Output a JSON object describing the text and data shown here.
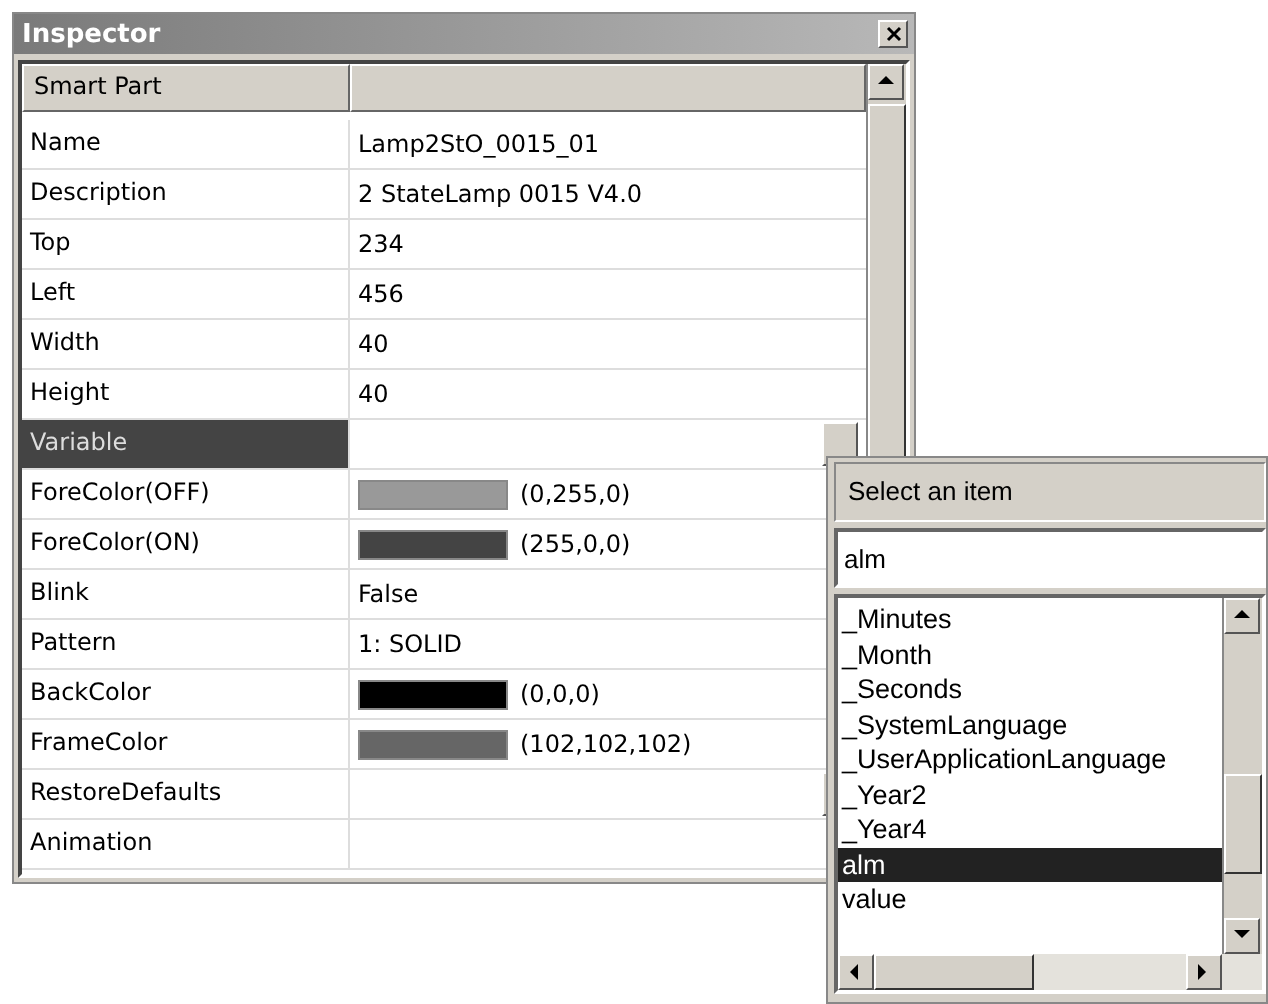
{
  "window": {
    "title": "Inspector"
  },
  "header": {
    "label": "Smart Part"
  },
  "rows": [
    {
      "name": "Name",
      "kind": "text",
      "value": "Lamp2StO_0015_01",
      "selected": false
    },
    {
      "name": "Description",
      "kind": "text",
      "value": "2 StateLamp 0015  V4.0",
      "selected": false
    },
    {
      "name": "Top",
      "kind": "text",
      "value": "234",
      "selected": false
    },
    {
      "name": "Left",
      "kind": "text",
      "value": "456",
      "selected": false
    },
    {
      "name": "Width",
      "kind": "text",
      "value": "40",
      "selected": false
    },
    {
      "name": "Height",
      "kind": "text",
      "value": "40",
      "selected": false
    },
    {
      "name": "Variable",
      "kind": "button",
      "value": "",
      "selected": true
    },
    {
      "name": "ForeColor(OFF)",
      "kind": "color",
      "value": "(0,255,0)",
      "color": "#999999",
      "selected": false
    },
    {
      "name": "ForeColor(ON)",
      "kind": "color",
      "value": "(255,0,0)",
      "color": "#444444",
      "selected": false
    },
    {
      "name": "Blink",
      "kind": "text",
      "value": "False",
      "selected": false
    },
    {
      "name": "Pattern",
      "kind": "text",
      "value": "1: SOLID",
      "selected": false
    },
    {
      "name": "BackColor",
      "kind": "color",
      "value": "(0,0,0)",
      "color": "#000000",
      "selected": false
    },
    {
      "name": "FrameColor",
      "kind": "color",
      "value": "(102,102,102)",
      "color": "#666666",
      "selected": false
    },
    {
      "name": "RestoreDefaults",
      "kind": "button",
      "value": "",
      "selected": false
    },
    {
      "name": "Animation",
      "kind": "text",
      "value": "",
      "selected": false
    }
  ],
  "popup": {
    "title": "Select an item",
    "filter": "alm",
    "items": [
      {
        "label": "_Minutes",
        "selected": false
      },
      {
        "label": "_Month",
        "selected": false
      },
      {
        "label": "_Seconds",
        "selected": false
      },
      {
        "label": "_SystemLanguage",
        "selected": false
      },
      {
        "label": "_UserApplicationLanguage",
        "selected": false
      },
      {
        "label": "_Year2",
        "selected": false
      },
      {
        "label": "_Year4",
        "selected": false
      },
      {
        "label": "alm",
        "selected": true
      },
      {
        "label": "value",
        "selected": false
      }
    ]
  }
}
